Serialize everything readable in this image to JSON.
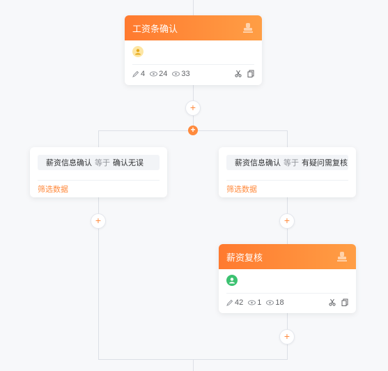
{
  "node1": {
    "title": "工资条确认",
    "stats": {
      "edit": "4",
      "view_a": "24",
      "view_b": "33"
    }
  },
  "node2": {
    "title": "薪资复核",
    "stats": {
      "edit": "42",
      "view_a": "1",
      "view_b": "18"
    }
  },
  "branch_left": {
    "field": "薪资信息确认",
    "operator": "等于",
    "value": "确认无误",
    "filter_label": "筛选数据"
  },
  "branch_right": {
    "field": "薪资信息确认",
    "operator": "等于",
    "value": "有疑问需复核",
    "filter_label": "筛选数据"
  },
  "add_symbol": "+",
  "colors": {
    "accent": "#ff8a3d",
    "header_start": "#ff7a2f",
    "header_end": "#ff9e45",
    "line": "#dcdfe6"
  },
  "icons": [
    "stamp-icon",
    "user-icon",
    "edit-icon",
    "eye-icon",
    "scissors-icon",
    "copy-icon"
  ]
}
